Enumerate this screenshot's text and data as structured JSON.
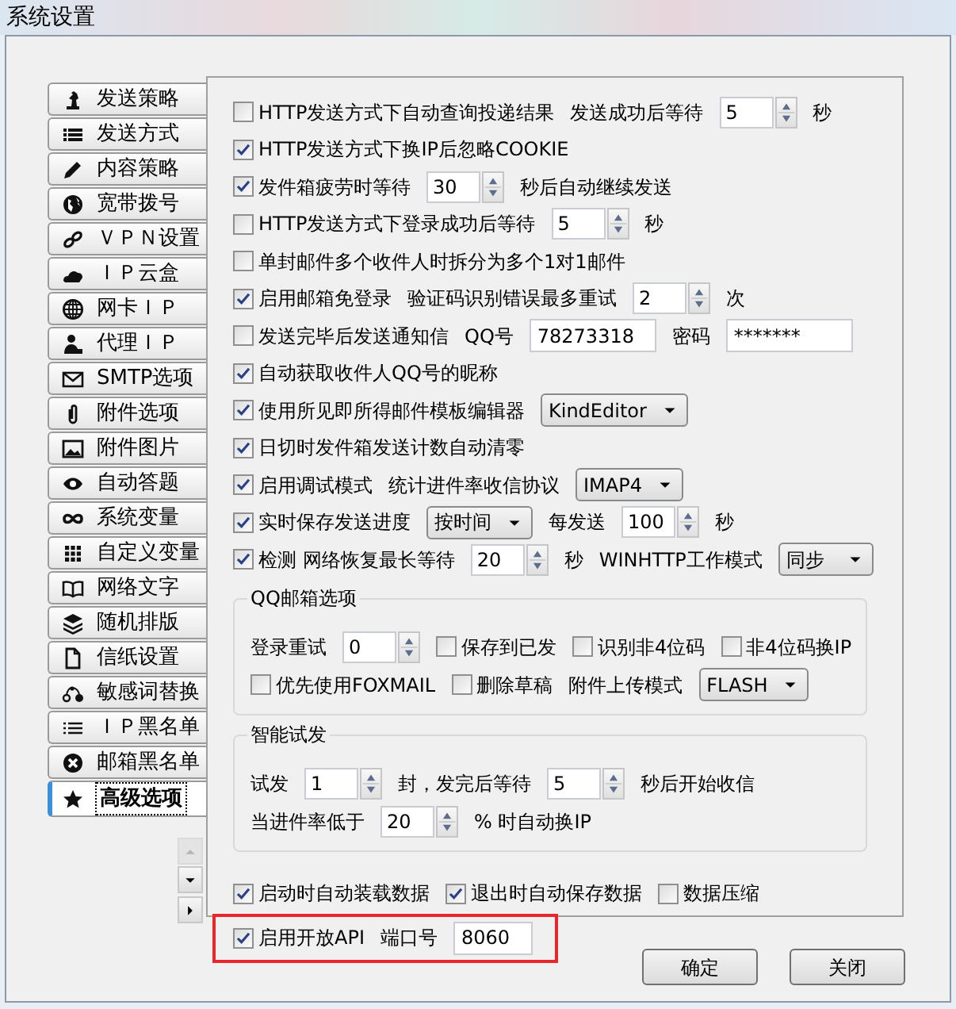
{
  "window": {
    "title": "系统设置"
  },
  "tabs": [
    {
      "label": "发送策略",
      "selected": false
    },
    {
      "label": "发送方式",
      "selected": false
    },
    {
      "label": "内容策略",
      "selected": false
    },
    {
      "label": "宽带拨号",
      "selected": false
    },
    {
      "label": "ＶＰＮ设置",
      "selected": false
    },
    {
      "label": "ＩＰ云盒",
      "selected": false
    },
    {
      "label": "网卡ＩＰ",
      "selected": false
    },
    {
      "label": "代理ＩＰ",
      "selected": false
    },
    {
      "label": "SMTP选项",
      "selected": false
    },
    {
      "label": "附件选项",
      "selected": false
    },
    {
      "label": "附件图片",
      "selected": false
    },
    {
      "label": "自动答题",
      "selected": false
    },
    {
      "label": "系统变量",
      "selected": false
    },
    {
      "label": "自定义变量",
      "selected": false
    },
    {
      "label": "网络文字",
      "selected": false
    },
    {
      "label": "随机排版",
      "selected": false
    },
    {
      "label": "信纸设置",
      "selected": false
    },
    {
      "label": "敏感词替换",
      "selected": false
    },
    {
      "label": "ＩＰ黑名单",
      "selected": false
    },
    {
      "label": "邮箱黑名单",
      "selected": false
    },
    {
      "label": "高级选项",
      "selected": true
    }
  ],
  "scroll_buttons": [
    {
      "kind": "up",
      "disabled": true
    },
    {
      "kind": "down",
      "disabled": false
    },
    {
      "kind": "right",
      "disabled": false
    }
  ],
  "options": [
    {
      "items": [
        {
          "kind": "checkbox",
          "label": "HTTP发送方式下自动查询投递结果",
          "checked": false
        },
        {
          "kind": "text",
          "text": "发送成功后等待"
        },
        {
          "kind": "spin",
          "value": "5"
        },
        {
          "kind": "text",
          "text": "秒"
        }
      ]
    },
    {
      "items": [
        {
          "kind": "checkbox",
          "label": "HTTP发送方式下换IP后忽略COOKIE",
          "checked": true
        }
      ]
    },
    {
      "items": [
        {
          "kind": "checkbox",
          "label": "发件箱疲劳时等待",
          "checked": true
        },
        {
          "kind": "spin",
          "value": "30"
        },
        {
          "kind": "text",
          "text": "秒后自动继续发送"
        }
      ]
    },
    {
      "items": [
        {
          "kind": "checkbox",
          "label": "HTTP发送方式下登录成功后等待",
          "checked": false
        },
        {
          "kind": "spin",
          "value": "5"
        },
        {
          "kind": "text",
          "text": "秒"
        }
      ]
    },
    {
      "items": [
        {
          "kind": "checkbox",
          "label": "单封邮件多个收件人时拆分为多个1对1邮件",
          "checked": false
        }
      ]
    },
    {
      "items": [
        {
          "kind": "checkbox",
          "label": "启用邮箱免登录",
          "checked": true
        },
        {
          "kind": "text",
          "text": "验证码识别错误最多重试"
        },
        {
          "kind": "spin",
          "value": "2"
        },
        {
          "kind": "text",
          "text": "次"
        }
      ]
    },
    {
      "items": [
        {
          "kind": "checkbox",
          "label": "发送完毕后发送通知信",
          "checked": false
        },
        {
          "kind": "text",
          "text": "QQ号"
        },
        {
          "kind": "input",
          "value": "78273318"
        },
        {
          "kind": "text",
          "text": "密码"
        },
        {
          "kind": "input",
          "value": "*******"
        }
      ]
    },
    {
      "items": [
        {
          "kind": "checkbox",
          "label": "自动获取收件人QQ号的昵称",
          "checked": true
        }
      ]
    },
    {
      "items": [
        {
          "kind": "checkbox",
          "label": "使用所见即所得邮件模板编辑器",
          "checked": true
        },
        {
          "kind": "select",
          "value": "KindEditor"
        }
      ]
    },
    {
      "items": [
        {
          "kind": "checkbox",
          "label": "日切时发件箱发送计数自动清零",
          "checked": true
        }
      ]
    },
    {
      "items": [
        {
          "kind": "checkbox",
          "label": "启用调试模式",
          "checked": true
        },
        {
          "kind": "text",
          "text": "统计进件率收信协议"
        },
        {
          "kind": "select",
          "value": "IMAP4"
        }
      ]
    },
    {
      "items": [
        {
          "kind": "checkbox",
          "label": "实时保存发送进度",
          "checked": true
        },
        {
          "kind": "select",
          "value": "按时间"
        },
        {
          "kind": "text",
          "text": "每发送"
        },
        {
          "kind": "spin",
          "value": "100"
        },
        {
          "kind": "text",
          "text": "秒"
        }
      ]
    },
    {
      "items": [
        {
          "kind": "checkbox",
          "label": "检测 网络恢复最长等待",
          "checked": true
        },
        {
          "kind": "spin",
          "value": "20"
        },
        {
          "kind": "text",
          "text": "秒"
        },
        {
          "kind": "text",
          "text": "WINHTTP工作模式"
        },
        {
          "kind": "select",
          "value": "同步"
        }
      ]
    }
  ],
  "groups": [
    {
      "title": "QQ邮箱选项",
      "rows": [
        {
          "items": [
            {
              "kind": "text",
              "text": "登录重试"
            },
            {
              "kind": "spin",
              "value": "0"
            },
            {
              "kind": "checkbox",
              "label": "保存到已发",
              "checked": false
            },
            {
              "kind": "checkbox",
              "label": "识别非4位码",
              "checked": false
            },
            {
              "kind": "checkbox",
              "label": "非4位码换IP",
              "checked": false
            }
          ]
        },
        {
          "items": [
            {
              "kind": "checkbox",
              "label": "优先使用FOXMAIL",
              "checked": false
            },
            {
              "kind": "checkbox",
              "label": "删除草稿",
              "checked": false
            },
            {
              "kind": "text",
              "text": "附件上传模式"
            },
            {
              "kind": "select",
              "value": "FLASH"
            }
          ]
        }
      ]
    },
    {
      "title": "智能试发",
      "rows": [
        {
          "items": [
            {
              "kind": "text",
              "text": "试发"
            },
            {
              "kind": "spin",
              "value": "1"
            },
            {
              "kind": "text",
              "text": "封，发完后等待"
            },
            {
              "kind": "spin",
              "value": "5"
            },
            {
              "kind": "text",
              "text": "秒后开始收信"
            }
          ]
        },
        {
          "items": [
            {
              "kind": "text",
              "text": "当进件率低于"
            },
            {
              "kind": "spin",
              "value": "20"
            },
            {
              "kind": "text",
              "text": "% 时自动换IP"
            }
          ]
        }
      ]
    }
  ],
  "footer_rows": [
    {
      "highlighted": false,
      "items": [
        {
          "kind": "checkbox",
          "label": "启动时自动装载数据",
          "checked": true
        },
        {
          "kind": "checkbox",
          "label": "退出时自动保存数据",
          "checked": true
        },
        {
          "kind": "checkbox",
          "label": "数据压缩",
          "checked": false
        }
      ]
    },
    {
      "highlighted": true,
      "items": [
        {
          "kind": "checkbox",
          "label": "启用开放API",
          "checked": true
        },
        {
          "kind": "text",
          "text": "端口号"
        },
        {
          "kind": "input",
          "value": "8060"
        }
      ]
    }
  ],
  "buttons": [
    "确定",
    "关闭"
  ]
}
